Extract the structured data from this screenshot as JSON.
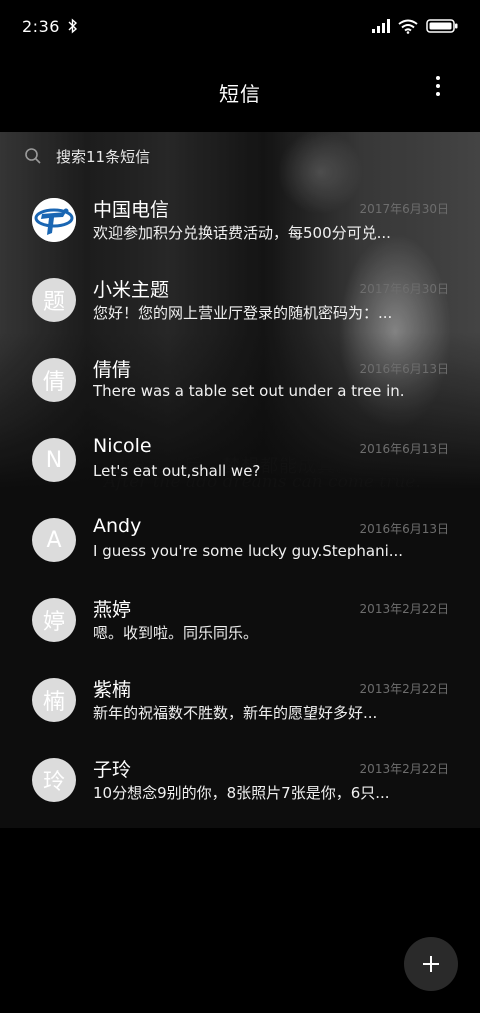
{
  "status": {
    "time": "2:36"
  },
  "header": {
    "title": "短信"
  },
  "search": {
    "label": "搜索11条短信"
  },
  "background": {
    "watermark_cn": "愿纷扰过后，梦想都能成真。",
    "watermark_en": "After the ado dreams can come true."
  },
  "conversations": [
    {
      "name": "中国电信",
      "avatar": "",
      "date": "2017年6月30日",
      "preview": "欢迎参加积分兑换话费活动，每500分可兑..."
    },
    {
      "name": "小米主题",
      "avatar": "题",
      "date": "2017年6月30日",
      "preview": "您好！您的网上营业厅登录的随机密码为：..."
    },
    {
      "name": "倩倩",
      "avatar": "倩",
      "date": "2016年6月13日",
      "preview": "There was a table set out under a tree in..."
    },
    {
      "name": "Nicole",
      "avatar": "N",
      "date": "2016年6月13日",
      "preview": "Let's eat out,shall we?"
    },
    {
      "name": "Andy",
      "avatar": "A",
      "date": "2016年6月13日",
      "preview": "I guess you're some lucky guy.Stephani..."
    },
    {
      "name": "燕婷",
      "avatar": "婷",
      "date": "2013年2月22日",
      "preview": "嗯。收到啦。同乐同乐。"
    },
    {
      "name": "紫楠",
      "avatar": "楠",
      "date": "2013年2月22日",
      "preview": "新年的祝福数不胜数，新年的愿望好多好..."
    },
    {
      "name": "子玲",
      "avatar": "玲",
      "date": "2013年2月22日",
      "preview": "10分想念9别的你，8张照片7张是你，6只..."
    }
  ],
  "icons": {
    "bluetooth": "bluetooth-icon",
    "signal": "signal-icon",
    "wifi": "wifi-icon",
    "battery": "battery-icon",
    "more": "more-vert-icon",
    "search": "search-icon",
    "compose": "plus-icon"
  },
  "colors": {
    "background": "#000000",
    "list_bg": "#0d0d0d",
    "date_text": "#6d6d6d",
    "avatar_bg": "#dcdcdc",
    "fab_bg": "#2a2a2a",
    "telecom_blue": "#1a66b3"
  }
}
